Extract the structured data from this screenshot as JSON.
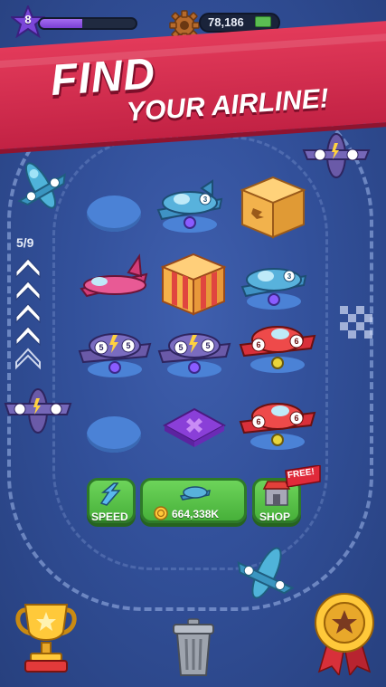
{
  "hud": {
    "level": "8",
    "xp_progress": 0.44,
    "coins": "78,186"
  },
  "banner": {
    "line1": "FIND",
    "line2": "YOUR AIRLINE!"
  },
  "runway": {
    "progress_label": "5/9"
  },
  "slots": [
    {
      "content": "empty"
    },
    {
      "content": "plane-teal",
      "level": "3"
    },
    {
      "content": "crate"
    },
    {
      "content": "plane-pink"
    },
    {
      "content": "gift-box"
    },
    {
      "content": "plane-teal",
      "level": "3"
    },
    {
      "content": "plane-purple",
      "level": "5"
    },
    {
      "content": "plane-purple",
      "level": "5"
    },
    {
      "content": "plane-red",
      "level": "6"
    },
    {
      "content": "empty"
    },
    {
      "content": "add-slot"
    },
    {
      "content": "plane-red",
      "level": "6"
    }
  ],
  "buttons": {
    "speed_label": "SPEED",
    "buy_price": "664,338K",
    "shop_label": "SHOP",
    "free_badge": "FREE!"
  },
  "colors": {
    "background": "#32509a",
    "banner": "#d92c4f",
    "button_green": "#55bf45",
    "xp_purple": "#8b4de0"
  },
  "icons": [
    "star-level-icon",
    "gear-icon",
    "cash-icon",
    "speed-icon",
    "coin-icon",
    "shop-icon",
    "trophy-icon",
    "trash-icon",
    "medal-icon",
    "checkered-flag-icon"
  ]
}
